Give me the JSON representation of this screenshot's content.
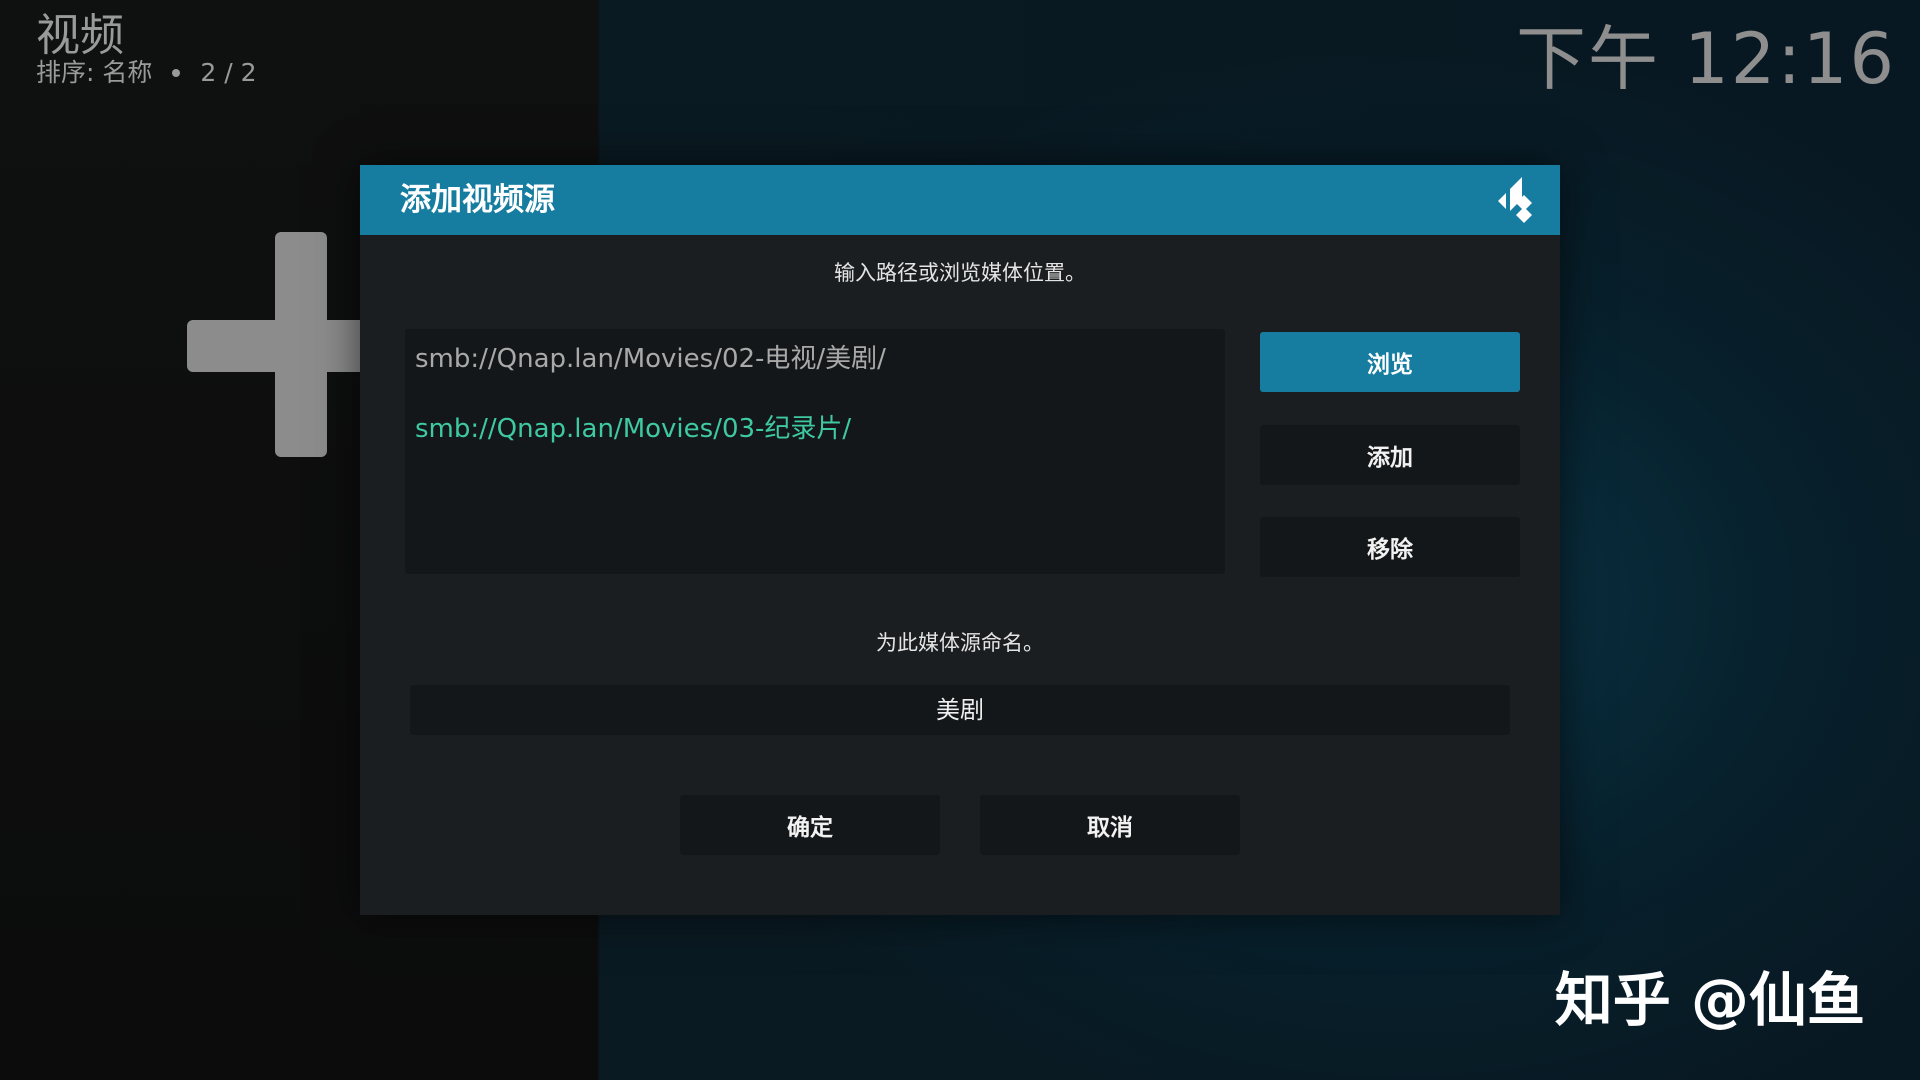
{
  "header": {
    "title": "视频",
    "sort_label": "排序: 名称",
    "page_count": "2 / 2"
  },
  "clock": "下午 12:16",
  "dialog": {
    "title": "添加视频源",
    "logo_icon": "kodi-logo-icon",
    "path_prompt": "输入路径或浏览媒体位置。",
    "paths": [
      "smb://Qnap.lan/Movies/02-电视/美剧/",
      "smb://Qnap.lan/Movies/03-纪录片/"
    ],
    "buttons": {
      "browse": "浏览",
      "add": "添加",
      "remove": "移除"
    },
    "name_prompt": "为此媒体源命名。",
    "name_value": "美剧",
    "ok": "确定",
    "cancel": "取消"
  },
  "background_icon": "plus-icon",
  "watermark": "知乎 @仙鱼",
  "colors": {
    "accent": "#177da0",
    "highlight_path": "#3ec9a0"
  }
}
